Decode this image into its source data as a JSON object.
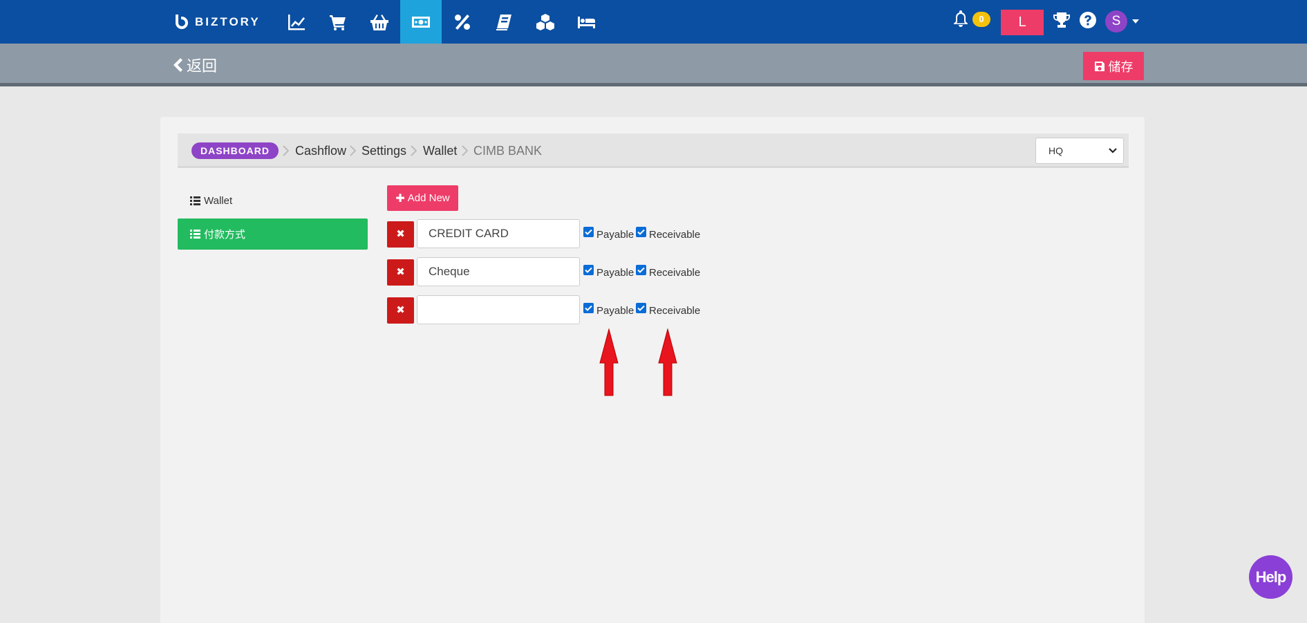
{
  "navbar": {
    "brand": "BIZTORY",
    "icons": [
      "chart-line-icon",
      "cart-icon",
      "basket-icon",
      "money-icon",
      "percent-icon",
      "book-icon",
      "cubes-icon",
      "bed-icon"
    ],
    "active_icon": "money-icon",
    "notification_count": "0",
    "user_button_label": "L",
    "avatar_initial": "S"
  },
  "subheader": {
    "back_label": "返回",
    "save_label": "储存"
  },
  "breadcrumb": {
    "dashboard": "DASHBOARD",
    "items": [
      "Cashflow",
      "Settings",
      "Wallet",
      "CIMB BANK"
    ]
  },
  "branch_select": {
    "selected": "HQ"
  },
  "sidebar": {
    "items": [
      {
        "label": "Wallet",
        "active": false
      },
      {
        "label": "付款方式",
        "active": true
      }
    ]
  },
  "payment_methods": {
    "add_new_label": "Add New",
    "delete_label": "✖",
    "payable_label": "Payable",
    "receivable_label": "Receivable",
    "rows": [
      {
        "value": "CREDIT CARD",
        "payable": true,
        "receivable": true
      },
      {
        "value": "Cheque",
        "payable": true,
        "receivable": true
      },
      {
        "value": "",
        "payable": true,
        "receivable": true
      }
    ]
  },
  "help_widget": {
    "label": "Help"
  },
  "colors": {
    "navbar": "#0a4fa1",
    "active_nav": "#1fa3dc",
    "accent_pink": "#ee3c68",
    "dashboard_badge": "#8e44c6",
    "sidebar_active": "#22bb5f",
    "delete_red": "#cc1a1a",
    "annotation_arrow": "#e8141e"
  }
}
